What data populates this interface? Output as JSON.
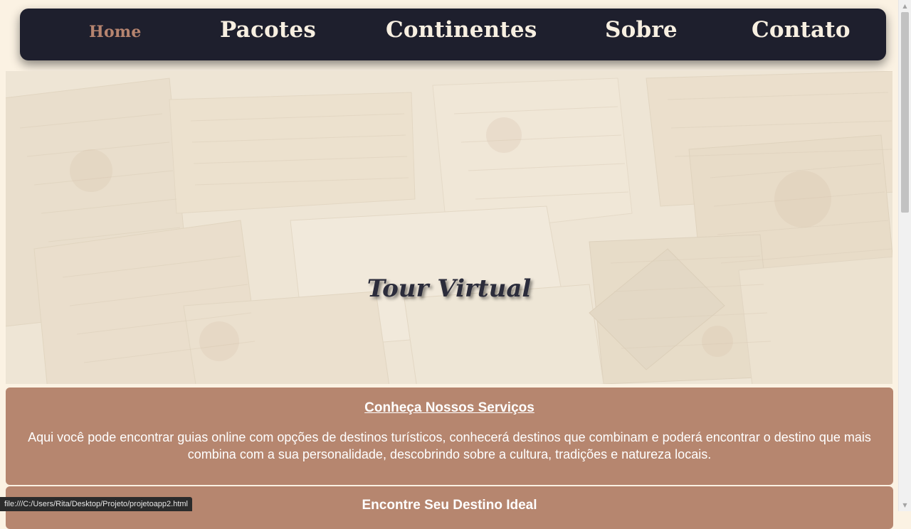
{
  "nav": {
    "items": [
      {
        "label": "Home",
        "active": true
      },
      {
        "label": "Pacotes",
        "active": false
      },
      {
        "label": "Continentes",
        "active": false
      },
      {
        "label": "Sobre",
        "active": false
      },
      {
        "label": "Contato",
        "active": false
      }
    ]
  },
  "hero": {
    "title": "Tour Virtual"
  },
  "services": {
    "title": "Conheça Nossos Serviços",
    "text": "Aqui você pode encontrar guias online com opções de destinos turísticos, conhecerá destinos que combinam e poderá encontrar o destino que mais combina com a sua personalidade, descobrindo sobre a cultura, tradições e natureza locais."
  },
  "destino": {
    "title": "Encontre Seu Destino Ideal"
  },
  "status": {
    "url": "file:///C:/Users/Rita/Desktop/Projeto/projetoapp2.html"
  },
  "colors": {
    "nav_bg": "#1e1f2d",
    "nav_text": "#f7efe1",
    "nav_active": "#b6846f",
    "card_bg": "#b6866f",
    "page_bg": "#fbf2e3"
  }
}
